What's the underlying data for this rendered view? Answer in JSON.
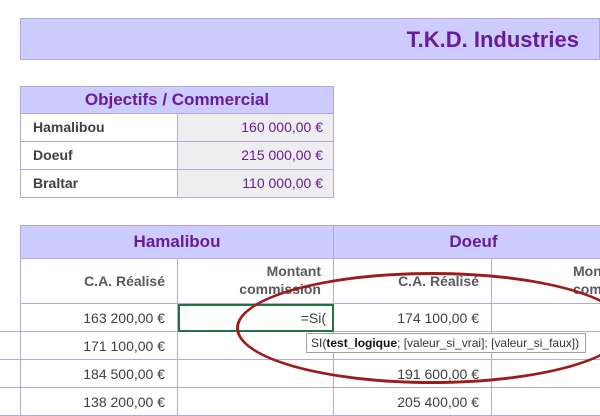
{
  "title": "T.K.D. Industries",
  "objectives": {
    "header": "Objectifs / Commercial",
    "rows": [
      {
        "name": "Hamalibou",
        "value": "160 000,00 €"
      },
      {
        "name": "Doeuf",
        "value": "215 000,00 €"
      },
      {
        "name": "Braltar",
        "value": "110 000,00 €"
      }
    ]
  },
  "table": {
    "groups": [
      {
        "name": "Hamalibou"
      },
      {
        "name": "Doeuf"
      }
    ],
    "col_ca": "C.A. Réalisé",
    "col_montant_1": "Montant",
    "col_montant_2": "commission",
    "col_montant_cut_1": "Mont",
    "col_montant_cut_2": "commi",
    "hamalibou_ca": [
      "163 200,00 €",
      "171 100,00 €",
      "184 500,00 €",
      "138 200,00 €"
    ],
    "doeuf_ca": [
      "174 100,00 €",
      "",
      "191 600,00 €",
      "205 400,00 €"
    ],
    "active_formula": "=Si("
  },
  "tooltip": {
    "prefix": "SI(",
    "bold": "test_logique",
    "rest": "; [valeur_si_vrai]; [valeur_si_faux])"
  },
  "colors": {
    "header_fill": "#ccccff",
    "accent_text": "#6a1b9a",
    "annotation": "#9e1b1b",
    "active_cell_border": "#217346"
  }
}
